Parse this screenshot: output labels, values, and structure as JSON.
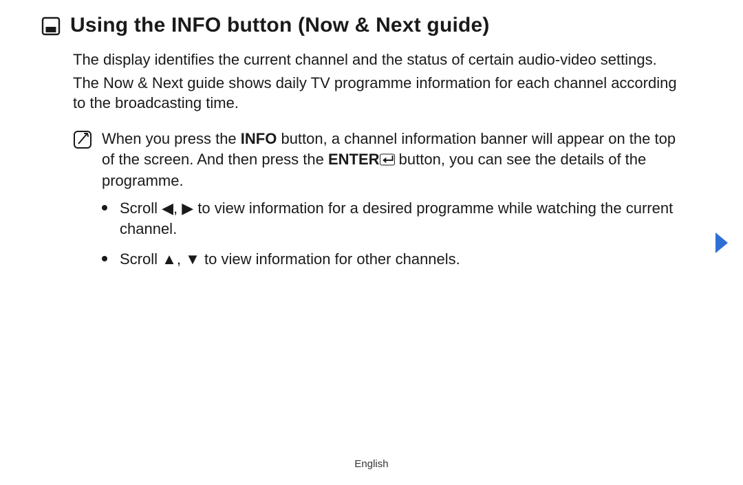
{
  "heading": "Using the INFO button (Now & Next guide)",
  "para1": "The display identifies the current channel and the status of certain audio-video settings.",
  "para2": "The Now & Next guide shows daily TV programme information for each channel according to the broadcasting time.",
  "note": {
    "pre": "When you press the ",
    "key1": "INFO",
    "mid1": " button, a channel information banner will appear on the top of the screen. And then press the ",
    "key2": "ENTER",
    "mid2": " button, you can see the details of the programme."
  },
  "bullets": [
    {
      "pre": "Scroll ",
      "sym1": "◀",
      "sep": ", ",
      "sym2": "▶",
      "post": " to view information for a desired programme while watching the current channel."
    },
    {
      "pre": "Scroll ",
      "sym1": "▲",
      "sep": ", ",
      "sym2": "▼",
      "post": " to view information for other channels."
    }
  ],
  "footer_language": "English"
}
